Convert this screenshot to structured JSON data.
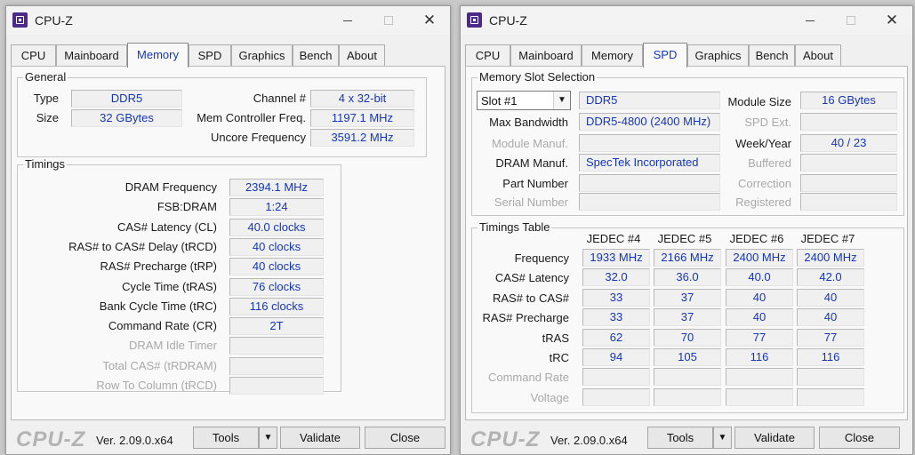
{
  "app": {
    "title": "CPU-Z",
    "logo": "CPU-Z",
    "version": "Ver. 2.09.0.x64"
  },
  "tabs": [
    "CPU",
    "Mainboard",
    "Memory",
    "SPD",
    "Graphics",
    "Bench",
    "About"
  ],
  "footer": {
    "tools": "Tools",
    "validate": "Validate",
    "close": "Close"
  },
  "memory": {
    "general": {
      "legend": "General",
      "type_label": "Type",
      "type": "DDR5",
      "size_label": "Size",
      "size": "32 GBytes",
      "channel_label": "Channel #",
      "channel": "4 x 32-bit",
      "mcf_label": "Mem Controller Freq.",
      "mcf": "1197.1 MHz",
      "uncore_label": "Uncore Frequency",
      "uncore": "3591.2 MHz"
    },
    "timings": {
      "legend": "Timings",
      "rows": [
        {
          "label": "DRAM Frequency",
          "value": "2394.1 MHz",
          "disabled": false
        },
        {
          "label": "FSB:DRAM",
          "value": "1:24",
          "disabled": false
        },
        {
          "label": "CAS# Latency (CL)",
          "value": "40.0 clocks",
          "disabled": false
        },
        {
          "label": "RAS# to CAS# Delay (tRCD)",
          "value": "40 clocks",
          "disabled": false
        },
        {
          "label": "RAS# Precharge (tRP)",
          "value": "40 clocks",
          "disabled": false
        },
        {
          "label": "Cycle Time (tRAS)",
          "value": "76 clocks",
          "disabled": false
        },
        {
          "label": "Bank Cycle Time (tRC)",
          "value": "116 clocks",
          "disabled": false
        },
        {
          "label": "Command Rate (CR)",
          "value": "2T",
          "disabled": false
        },
        {
          "label": "DRAM Idle Timer",
          "value": "",
          "disabled": true
        },
        {
          "label": "Total CAS# (tRDRAM)",
          "value": "",
          "disabled": true
        },
        {
          "label": "Row To Column (tRCD)",
          "value": "",
          "disabled": true
        }
      ]
    }
  },
  "spd": {
    "slot": {
      "legend": "Memory Slot Selection",
      "selected": "Slot #1",
      "type": "DDR5",
      "module_size_label": "Module Size",
      "module_size": "16 GBytes",
      "max_bw_label": "Max Bandwidth",
      "max_bw": "DDR5-4800 (2400 MHz)",
      "spd_ext_label": "SPD Ext.",
      "spd_ext": "",
      "module_manuf_label": "Module Manuf.",
      "module_manuf": "",
      "week_year_label": "Week/Year",
      "week_year": "40 / 23",
      "dram_manuf_label": "DRAM Manuf.",
      "dram_manuf": "SpecTek Incorporated",
      "buffered_label": "Buffered",
      "buffered": "",
      "part_number_label": "Part Number",
      "part_number": "",
      "correction_label": "Correction",
      "correction": "",
      "serial_number_label": "Serial Number",
      "serial_number": "",
      "registered_label": "Registered",
      "registered": ""
    },
    "timings": {
      "legend": "Timings Table",
      "columns": [
        "JEDEC #4",
        "JEDEC #5",
        "JEDEC #6",
        "JEDEC #7"
      ],
      "rows": [
        {
          "label": "Frequency",
          "values": [
            "1933 MHz",
            "2166 MHz",
            "2400 MHz",
            "2400 MHz"
          ],
          "disabled": false
        },
        {
          "label": "CAS# Latency",
          "values": [
            "32.0",
            "36.0",
            "40.0",
            "42.0"
          ],
          "disabled": false
        },
        {
          "label": "RAS# to CAS#",
          "values": [
            "33",
            "37",
            "40",
            "40"
          ],
          "disabled": false
        },
        {
          "label": "RAS# Precharge",
          "values": [
            "33",
            "37",
            "40",
            "40"
          ],
          "disabled": false
        },
        {
          "label": "tRAS",
          "values": [
            "62",
            "70",
            "77",
            "77"
          ],
          "disabled": false
        },
        {
          "label": "tRC",
          "values": [
            "94",
            "105",
            "116",
            "116"
          ],
          "disabled": false
        },
        {
          "label": "Command Rate",
          "values": [
            "",
            "",
            "",
            ""
          ],
          "disabled": true
        },
        {
          "label": "Voltage",
          "values": [
            "",
            "",
            "",
            ""
          ],
          "disabled": true
        }
      ]
    }
  },
  "colors": {
    "value_text": "#1636b8",
    "disabled_text": "#a9a9a9",
    "window_bg": "#f0f0f0",
    "panel_bg": "#f9f9f9"
  }
}
